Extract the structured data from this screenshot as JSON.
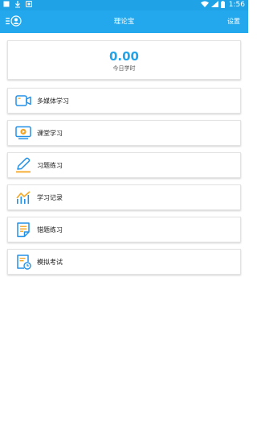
{
  "status_bar": {
    "time": "1:56",
    "background_color": "#1fa2e6"
  },
  "app_bar": {
    "title": "理论宝",
    "settings_label": "设置",
    "menu_icon": "menu-profile-icon",
    "background_color": "#23a8ee"
  },
  "summary": {
    "value": "0.00",
    "label": "今日学时",
    "accent_color": "#23a4e9"
  },
  "menu": [
    {
      "label": "多媒体学习",
      "icon": "video-camera-icon"
    },
    {
      "label": "课堂学习",
      "icon": "monitor-play-icon"
    },
    {
      "label": "习题练习",
      "icon": "pencil-icon"
    },
    {
      "label": "学习记录",
      "icon": "line-chart-icon"
    },
    {
      "label": "错题练习",
      "icon": "notepad-icon"
    },
    {
      "label": "模拟考试",
      "icon": "exam-clock-icon"
    }
  ],
  "colors": {
    "icon_blue": "#2491e6",
    "icon_orange": "#f5a623"
  }
}
